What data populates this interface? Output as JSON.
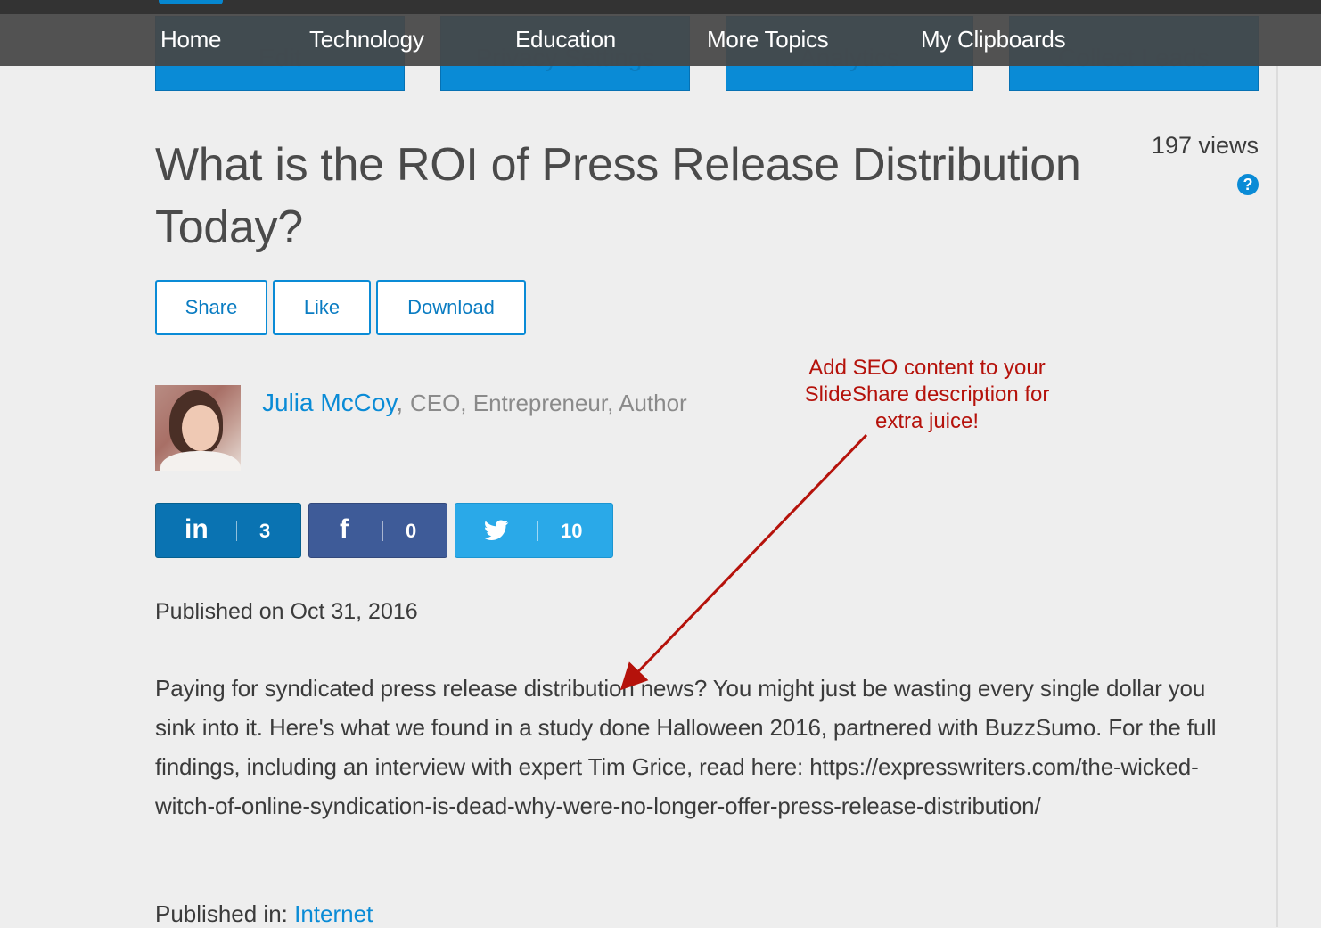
{
  "nav": {
    "items": [
      {
        "label": "Home"
      },
      {
        "label": "Technology"
      },
      {
        "label": "Education"
      },
      {
        "label": "More Topics"
      },
      {
        "label": "My Clipboards"
      }
    ]
  },
  "tools": {
    "labels": [
      "Edit",
      "Privacy Settings",
      "Analytics",
      "Collect Leads"
    ]
  },
  "presentation": {
    "title": "What is the ROI of Press Release Distribution Today?",
    "views": "197 views",
    "help_icon": "?"
  },
  "actions": {
    "share": "Share",
    "like": "Like",
    "download": "Download"
  },
  "author": {
    "name": "Julia McCoy",
    "separator": ",",
    "roles": "CEO, Entrepreneur, Author"
  },
  "social": {
    "linkedin": {
      "icon": "in",
      "count": "3"
    },
    "facebook": {
      "icon": "f",
      "count": "0"
    },
    "twitter": {
      "icon": "twitter-bird-icon",
      "count": "10"
    }
  },
  "published_date": "Published on Oct 31, 2016",
  "description": "Paying for syndicated press release distribution news? You might just be wasting every single dollar you sink into it. Here's what we found in a study done Halloween 2016, partnered with BuzzSumo. For the full findings, including an interview with expert Tim Grice, read here: https://expresswriters.com/the-wicked-witch-of-online-syndication-is-dead-why-were-no-longer-offer-press-release-distribution/",
  "published_in": {
    "label": "Published in:",
    "category": "Internet"
  },
  "annotation": {
    "text": "Add SEO content to your SlideShare description for extra juice!",
    "color": "#b5120b"
  },
  "colors": {
    "accent": "#0a8bd6",
    "nav_bg": "#464646",
    "linkedin": "#0a73b2",
    "facebook": "#3e5b98",
    "twitter": "#2aa9e8"
  }
}
